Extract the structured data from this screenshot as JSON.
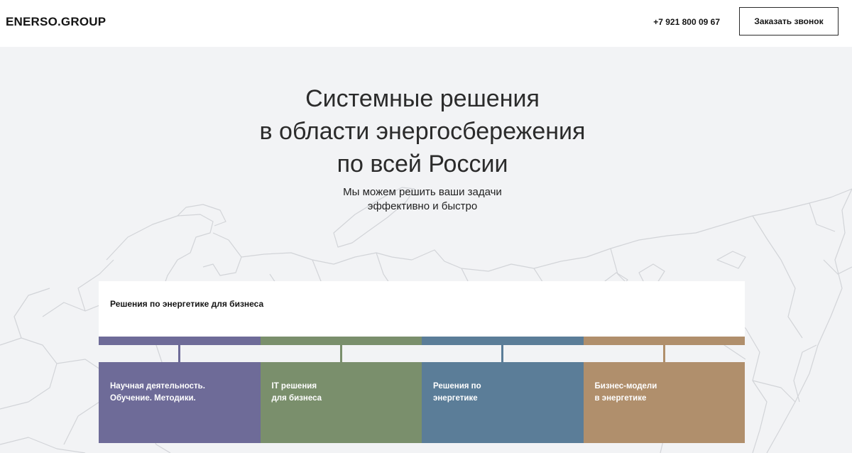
{
  "header": {
    "logo": "ENERSO.GROUP",
    "phone": "+7 921 800 09 67",
    "callback_label": "Заказать звонок"
  },
  "hero": {
    "title_lines": [
      "Системные решения",
      "в области энергосбережения",
      "по всей России"
    ],
    "subtitle_lines": [
      "Мы можем решить ваши задачи",
      "эффективно и быстро"
    ]
  },
  "solutions": {
    "title": "Решения по энергетике для бизнеса",
    "cards": [
      {
        "lines": [
          "Научная деятельность.",
          "Обучение. Методики."
        ],
        "color": "#6e6b98"
      },
      {
        "lines": [
          "IT решения",
          "для бизнеса"
        ],
        "color": "#7a8f6c"
      },
      {
        "lines": [
          "Решения  по",
          "энергетике"
        ],
        "color": "#5b7d98"
      },
      {
        "lines": [
          "Бизнес-модели",
          "в энергетике"
        ],
        "color": "#b08f6c"
      }
    ]
  },
  "colors": {
    "background": "#f2f3f5",
    "map_lines": "#d2d4d8"
  }
}
